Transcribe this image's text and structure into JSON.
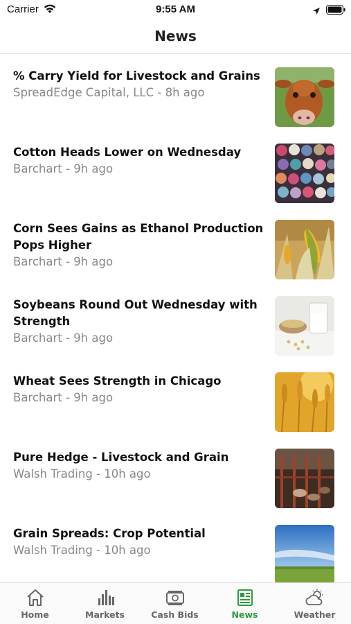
{
  "status_bar": {
    "carrier": "Carrier",
    "time": "9:55 AM"
  },
  "header": {
    "title": "News"
  },
  "news": [
    {
      "title": "% Carry Yield for Livestock and Grains",
      "meta": "SpreadEdge Capital, LLC - 8h ago",
      "thumb": "cow-photo"
    },
    {
      "title": "Cotton Heads Lower on Wednesday",
      "meta": "Barchart - 9h ago",
      "thumb": "fabric-rolls-photo"
    },
    {
      "title": "Corn Sees Gains as Ethanol Production Pops Higher",
      "meta": "Barchart - 9h ago",
      "thumb": "corn-photo"
    },
    {
      "title": "Soybeans Round Out Wednesday with Strength",
      "meta": "Barchart - 9h ago",
      "thumb": "soybeans-milk-photo"
    },
    {
      "title": "Wheat Sees Strength in Chicago",
      "meta": "Barchart - 9h ago",
      "thumb": "wheat-photo"
    },
    {
      "title": "Pure Hedge - Livestock and Grain",
      "meta": "Walsh Trading - 10h ago",
      "thumb": "barn-photo"
    },
    {
      "title": "Grain Spreads: Crop Potential",
      "meta": "Walsh Trading - 10h ago",
      "thumb": "field-sky-photo"
    }
  ],
  "tabs": [
    {
      "label": "Home",
      "icon": "home-icon",
      "active": false
    },
    {
      "label": "Markets",
      "icon": "bar-chart-icon",
      "active": false
    },
    {
      "label": "Cash Bids",
      "icon": "cash-icon",
      "active": false
    },
    {
      "label": "News",
      "icon": "newspaper-icon",
      "active": true
    },
    {
      "label": "Weather",
      "icon": "weather-icon",
      "active": false
    }
  ],
  "colors": {
    "active_tab": "#2e9b3c",
    "inactive_tab": "#666666",
    "meta_text": "#888888"
  }
}
